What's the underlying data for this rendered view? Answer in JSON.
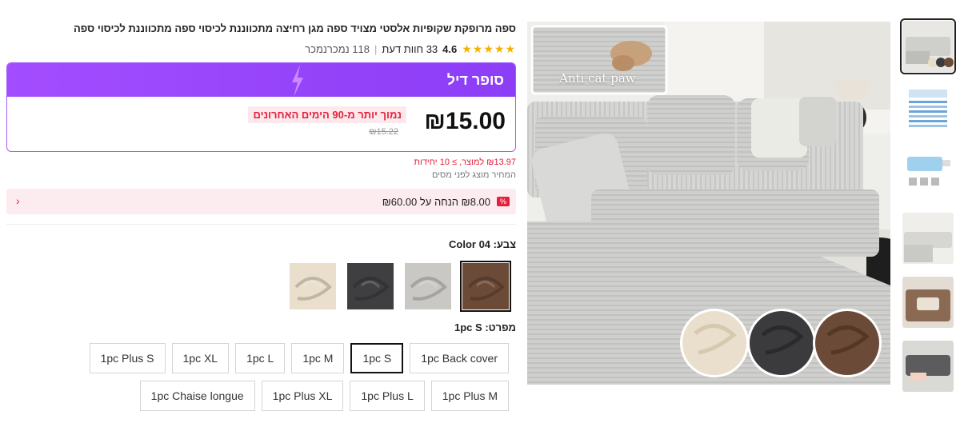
{
  "product": {
    "title": "ספה מרופקת שקופיות אלסטי מצויד ספה מגן רחיצה מתכווננת לכיסוי ספה מתכווננת לכיסוי ספה",
    "rating": "4.6",
    "stars": "★★★★★",
    "reviews": "33 חוות דעת",
    "sold": "118 נמכרנמכר"
  },
  "deal": {
    "title": "סופר דיל",
    "price": "₪15.00",
    "lowest_badge": "נמוך יותר מ-90 הימים האחרונים",
    "old_price": "₪15.22"
  },
  "bulk_text": "₪13.97 למוצר, ≥ 10 יחידות",
  "tax_text": "המחיר מוצג לפני מסים",
  "coupon": {
    "icon": "%",
    "text": "₪8.00 הנחה על ₪60.00",
    "chevron": "‹"
  },
  "color": {
    "label": "צבע: Color 04",
    "selected_index": 0,
    "swatches": [
      {
        "name": "brown",
        "hex": "#6b4a37"
      },
      {
        "name": "light-grey",
        "hex": "#c9c8c4"
      },
      {
        "name": "dark-grey",
        "hex": "#3f3f42"
      },
      {
        "name": "cream",
        "hex": "#e9dfcc"
      }
    ]
  },
  "size": {
    "label": "מפרט: 1pc S",
    "row1": [
      "1pc Back cover",
      "1pc S",
      "1pc M",
      "1pc L",
      "1pc XL",
      "1pc Plus S"
    ],
    "row2": [
      "1pc Plus M",
      "1pc Plus L",
      "1pc Plus XL",
      "1pc Chaise longue"
    ],
    "selected": "1pc S"
  },
  "main_image": {
    "inset_caption": "Anti cat paw"
  },
  "colors": {
    "accent_purple": "#9b45fb",
    "red": "#e4203c",
    "star": "#f5b100"
  }
}
